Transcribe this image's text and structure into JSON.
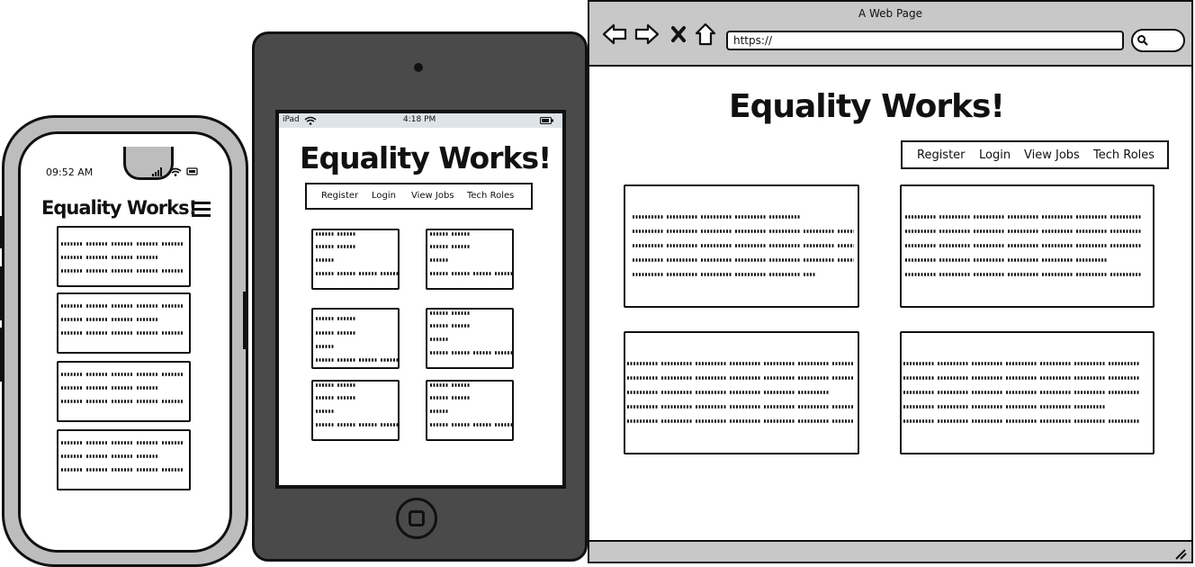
{
  "site_title": "Equality Works!",
  "nav": {
    "register": "Register",
    "login": "Login",
    "view_jobs": "View Jobs",
    "tech_roles": "Tech Roles"
  },
  "phone": {
    "time": "09:52 AM",
    "menu_icon": "hamburger-icon",
    "signal_icon": "signal-bars-icon",
    "wifi_icon": "wifi-icon",
    "battery_icon": "battery-icon"
  },
  "tablet": {
    "device_label": "iPad",
    "time": "4:18 PM",
    "wifi_icon": "wifi-icon",
    "battery_icon": "battery-icon"
  },
  "browser": {
    "window_title": "A Web Page",
    "url": "https://",
    "back_icon": "arrow-left-icon",
    "forward_icon": "arrow-right-icon",
    "stop_icon": "close-icon",
    "home_icon": "home-icon",
    "search_icon": "search-icon",
    "resize_icon": "resize-grip-icon"
  },
  "colors": {
    "device_frame": "#bdbdbd",
    "tablet_body": "#4a4a4a",
    "browser_chrome": "#c8c8c8",
    "tablet_statusbar": "#dde3e7",
    "ink": "#111111"
  }
}
